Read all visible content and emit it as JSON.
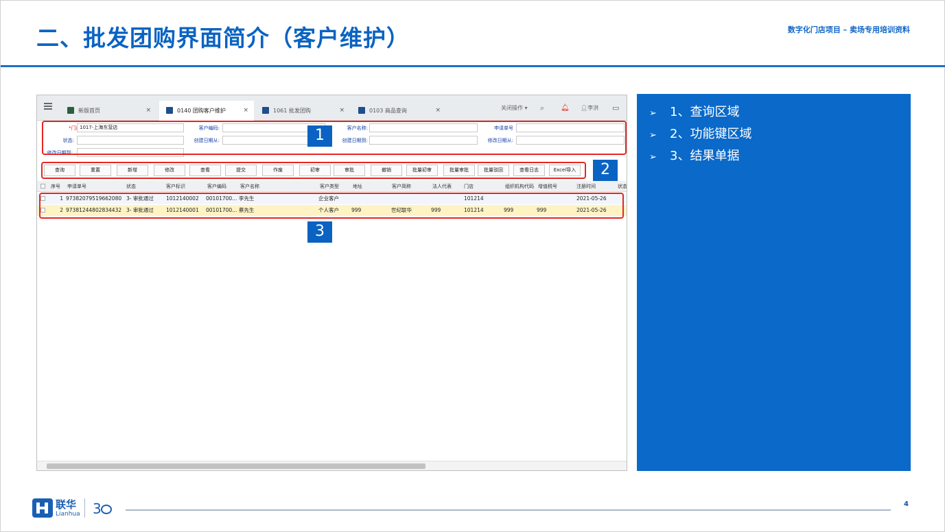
{
  "slide": {
    "title": "二、批发团购界面简介（客户维护）",
    "subtitle": "数字化门店项目 – 卖场专用培训资料",
    "page_number": "4"
  },
  "app": {
    "tabs": [
      {
        "label": "新版首页",
        "close": "×"
      },
      {
        "label": "0140 团购客户维护",
        "close": "×"
      },
      {
        "label": "1061 批发团购",
        "close": "×"
      },
      {
        "label": "0103 商品查询",
        "close": "×"
      }
    ],
    "toolbar": {
      "close_ops": "关闭操作",
      "user": "李洪"
    },
    "form": {
      "store_label": "*门店:",
      "store_value": "1017-上海东营店",
      "cust_code_label": "客户编码:",
      "cust_name_label": "客户名称:",
      "apply_no_label": "申请单号",
      "status_label": "状态:",
      "create_from_label": "创建日期从:",
      "create_to_label": "创建日期到:",
      "modify_from_label": "修改日期从:",
      "modify_to_label": "修改日期到:"
    },
    "buttons": [
      "查询",
      "重置",
      "新增",
      "修改",
      "查看",
      "提交",
      "作废",
      "初审",
      "审批",
      "撤销",
      "批量初审",
      "批量审批",
      "批量驳回",
      "查看日志",
      "Excel导入"
    ],
    "table": {
      "headers": [
        "序号",
        "申请单号",
        "状态",
        "客户标识",
        "客户编码",
        "客户名称",
        "客户类型",
        "地址",
        "客户简称",
        "法人代表",
        "门店",
        "组织机构代码",
        "增值税号",
        "注册时间",
        "状态"
      ],
      "rows": [
        [
          "1",
          "97382079519662080",
          "3- 审批通过",
          "1012140002",
          "00101700...",
          "李先生",
          "企业客户",
          "",
          "",
          "",
          "101214",
          "",
          "",
          "2021-05-26"
        ],
        [
          "2",
          "97381244802834432",
          "3- 审批通过",
          "1012140001",
          "00101700...",
          "蔡先生",
          "个人客户",
          "999",
          "世纪联华",
          "999",
          "101214",
          "999",
          "999",
          "2021-05-26"
        ]
      ]
    },
    "badges": [
      "1",
      "2",
      "3"
    ]
  },
  "panel": {
    "items": [
      "1、查询区域",
      "2、功能键区域",
      "3、结果单据"
    ]
  },
  "logo": {
    "name_cn": "联华",
    "name_en": "Lianhua"
  }
}
